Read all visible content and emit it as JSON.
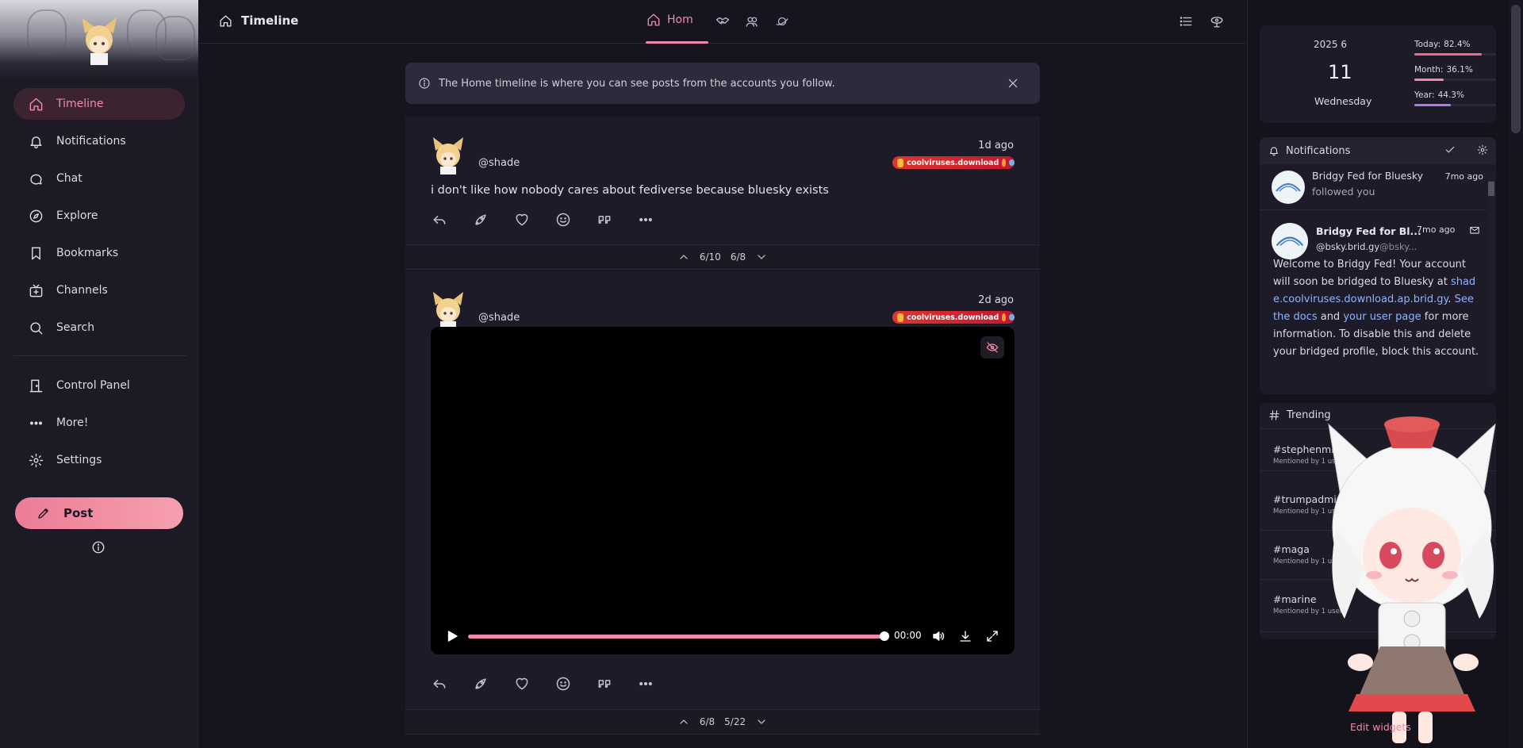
{
  "sidebar": {
    "items": [
      {
        "label": "Timeline",
        "icon": "home-icon",
        "active": true
      },
      {
        "label": "Notifications",
        "icon": "bell-icon"
      },
      {
        "label": "Chat",
        "icon": "chat-icon"
      },
      {
        "label": "Explore",
        "icon": "compass-icon"
      },
      {
        "label": "Bookmarks",
        "icon": "bookmark-icon"
      },
      {
        "label": "Channels",
        "icon": "channels-icon"
      },
      {
        "label": "Search",
        "icon": "search-icon"
      },
      {
        "label": "Control Panel",
        "icon": "door-icon"
      },
      {
        "label": "More!",
        "icon": "dots-icon"
      },
      {
        "label": "Settings",
        "icon": "gear-icon"
      }
    ],
    "post_label": "Post"
  },
  "header": {
    "title": "Timeline",
    "active_tab": "Hom",
    "tabs": [
      "handshake-icon",
      "users-icon",
      "planet-icon"
    ]
  },
  "info_banner": {
    "text": "The Home timeline is where you can see posts from the accounts you follow."
  },
  "notes": [
    {
      "user": "@shade",
      "time": "1d ago",
      "instance": "coolviruses.download",
      "text": "i don't like how nobody cares about fediverse because bluesky exists",
      "pager": {
        "a": "6/10",
        "b": "6/8"
      }
    },
    {
      "user": "@shade",
      "time": "2d ago",
      "instance": "coolviruses.download",
      "video_time": "00:00",
      "pager": {
        "a": "6/8",
        "b": "5/22"
      }
    }
  ],
  "calendar": {
    "year_month": "2025  6",
    "day": "11",
    "weekday": "Wednesday",
    "stats": [
      {
        "label": "Today:",
        "value": "82.4%",
        "fraction": 0.824,
        "color": "#f06a8a"
      },
      {
        "label": "Month:",
        "value": "36.1%",
        "fraction": 0.361,
        "color": "#f48aa8"
      },
      {
        "label": "Year:",
        "value": "44.3%",
        "fraction": 0.443,
        "color": "#b07ae8"
      }
    ]
  },
  "notifications_widget": {
    "title": "Notifications",
    "items": [
      {
        "name": "Bridgy Fed for Bluesky",
        "time": "7mo ago",
        "text": "followed you"
      },
      {
        "name": "Bridgy Fed for Bl...",
        "time": "7mo ago",
        "handle": "@bsky.brid.gy",
        "handle_host": "@bsky...",
        "body_1": "Welcome to Bridgy Fed! Your account will soon be bridged to Bluesky at ",
        "link_1": "shad e.coolviruses.download.ap.brid.gy",
        "body_2": ". ",
        "link_2": "See the docs",
        "body_3": " and ",
        "link_3": "your user page",
        "body_4": " for more information. To disable this and delete your bridged profile, block this account."
      }
    ]
  },
  "trending": {
    "title": "Trending",
    "items": [
      {
        "tag": "#stephenmille",
        "meta": "Mentioned by 1 users"
      },
      {
        "tag": "#trumpadmin",
        "meta": "Mentioned by 1 us"
      },
      {
        "tag": "#maga",
        "meta": "Mentioned by 1 users"
      },
      {
        "tag": "#marine",
        "meta": "Mentioned by 1 users"
      }
    ]
  },
  "edit_widgets_label": "Edit widgets"
}
